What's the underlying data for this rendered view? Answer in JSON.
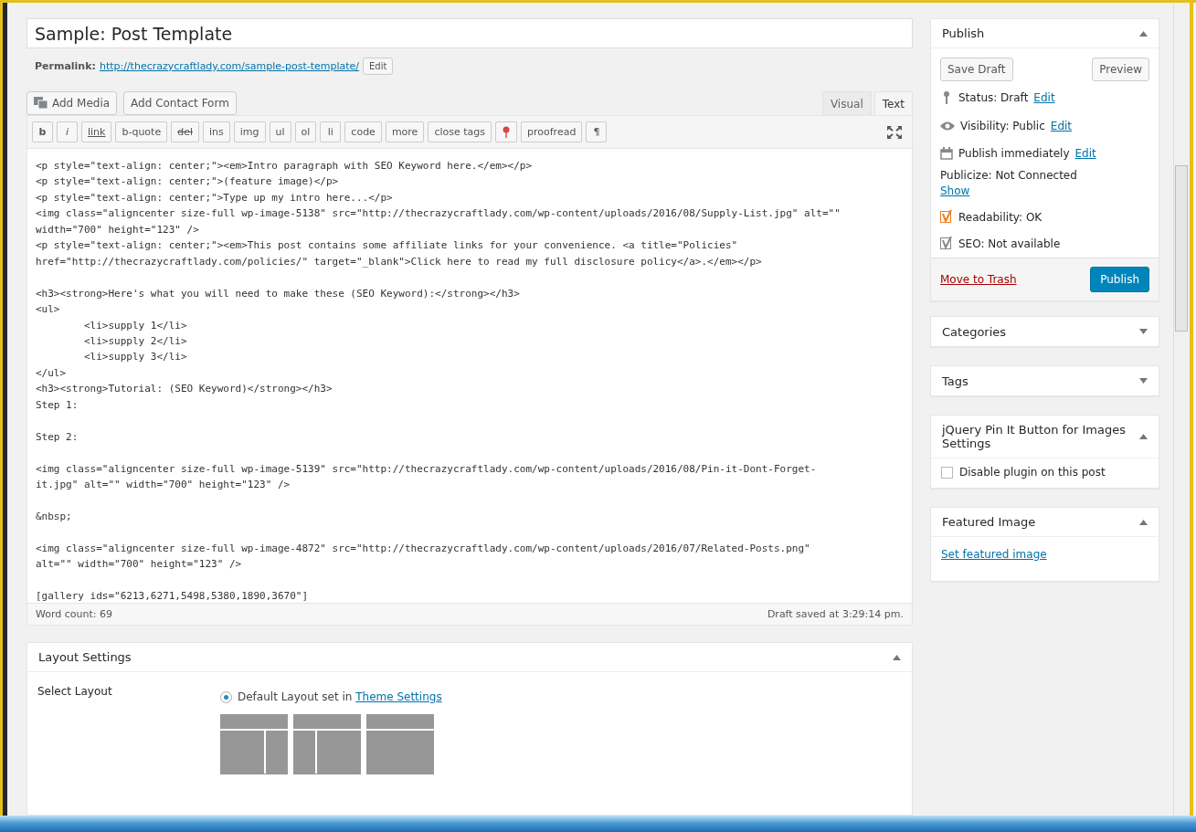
{
  "post": {
    "title": "Sample: Post Template",
    "permalink_label": "Permalink:",
    "permalink_url": "http://thecrazycraftlady.com/sample-post-template/",
    "permalink_edit": "Edit"
  },
  "media_buttons": [
    {
      "kind": "media",
      "label": "Add Media"
    },
    {
      "kind": "plain",
      "label": "Add Contact Form"
    }
  ],
  "editor_tabs": [
    {
      "label": "Visual",
      "selected": false
    },
    {
      "label": "Text",
      "selected": true
    }
  ],
  "quicktags": [
    {
      "kind": "bold",
      "label": "b"
    },
    {
      "kind": "italic",
      "label": "i"
    },
    {
      "kind": "underline",
      "label": "link"
    },
    {
      "kind": "plain",
      "label": "b-quote"
    },
    {
      "kind": "strike",
      "label": "del"
    },
    {
      "kind": "plain",
      "label": "ins"
    },
    {
      "kind": "plain",
      "label": "img"
    },
    {
      "kind": "plain",
      "label": "ul"
    },
    {
      "kind": "plain",
      "label": "ol"
    },
    {
      "kind": "plain",
      "label": "li"
    },
    {
      "kind": "plain",
      "label": "code"
    },
    {
      "kind": "plain",
      "label": "more"
    },
    {
      "kind": "plain",
      "label": "close tags"
    },
    {
      "kind": "pin"
    },
    {
      "kind": "plain",
      "label": "proofread"
    },
    {
      "kind": "plain",
      "label": "¶"
    }
  ],
  "code_blocks": [
    [
      "<p style=\"text-align: center;\"><em>Intro paragraph with SEO Keyword here.</em></p>",
      "<p style=\"text-align: center;\">(feature image)</p>",
      "<p style=\"text-align: center;\">Type up my intro here...</p>",
      "<img class=\"aligncenter size-full wp-image-5138\" src=\"http://thecrazycraftlady.com/wp-content/uploads/2016/08/Supply-List.jpg\" alt=\"\"",
      "width=\"700\" height=\"123\" />",
      "<p style=\"text-align: center;\"><em>This post contains some affiliate links for your convenience. <a title=\"Policies\"",
      "href=\"http://thecrazycraftlady.com/policies/\" target=\"_blank\">Click here to read my full disclosure policy</a>.</em></p>"
    ],
    [
      "<h3><strong>Here's what you will need to make these (SEO Keyword):</strong></h3>",
      "<ul>",
      "\t<li>supply 1</li>",
      "\t<li>supply 2</li>",
      "\t<li>supply 3</li>",
      "</ul>",
      "<h3><strong>Tutorial: (SEO Keyword)</strong></h3>",
      "Step 1:"
    ],
    [
      "Step 2:"
    ],
    [
      "<img class=\"aligncenter size-full wp-image-5139\" src=\"http://thecrazycraftlady.com/wp-content/uploads/2016/08/Pin-it-Dont-Forget-",
      "it.jpg\" alt=\"\" width=\"700\" height=\"123\" />"
    ],
    [
      "&nbsp;"
    ],
    [
      "<img class=\"aligncenter size-full wp-image-4872\" src=\"http://thecrazycraftlady.com/wp-content/uploads/2016/07/Related-Posts.png\"",
      "alt=\"\" width=\"700\" height=\"123\" />"
    ],
    [
      "[gallery ids=\"6213,6271,5498,5380,1890,3670\"]"
    ]
  ],
  "editor_footer": {
    "word_count": "Word count: 69",
    "saved": "Draft saved at 3:29:14 pm."
  },
  "layout_settings": {
    "title": "Layout Settings",
    "expanded": true,
    "label": "Select Layout",
    "option_text": "Default Layout set in",
    "option_link": "Theme Settings",
    "option_selected": true,
    "layouts": [
      {
        "kind": "sidebar-right"
      },
      {
        "kind": "sidebar-left"
      },
      {
        "kind": "full"
      }
    ]
  },
  "publish": {
    "title": "Publish",
    "expanded": true,
    "save_draft": "Save Draft",
    "preview": "Preview",
    "meta": [
      {
        "kind": "pin",
        "text": "Status: Draft",
        "link": "Edit"
      },
      {
        "kind": "eye",
        "text": "Visibility: Public",
        "link": "Edit"
      },
      {
        "kind": "calendar",
        "text": "Publish immediately",
        "link": "Edit"
      }
    ],
    "publicize": "Publicize: Not Connected",
    "publicize_link": "Show",
    "scores": [
      {
        "text": "Readability: OK",
        "color": "#ee7c1b"
      },
      {
        "text": "SEO: Not available",
        "color": "#888888"
      }
    ],
    "trash": "Move to Trash",
    "publish_button": "Publish"
  },
  "side_boxes": [
    {
      "title": "Categories",
      "expanded": false
    },
    {
      "title": "Tags",
      "expanded": false
    },
    {
      "kind": "checkbox",
      "title": "jQuery Pin It Button for Images Settings",
      "expanded": true,
      "option": "Disable plugin on this post",
      "checked": false
    },
    {
      "kind": "link",
      "title": "Featured Image",
      "expanded": true,
      "link": "Set featured image"
    }
  ]
}
